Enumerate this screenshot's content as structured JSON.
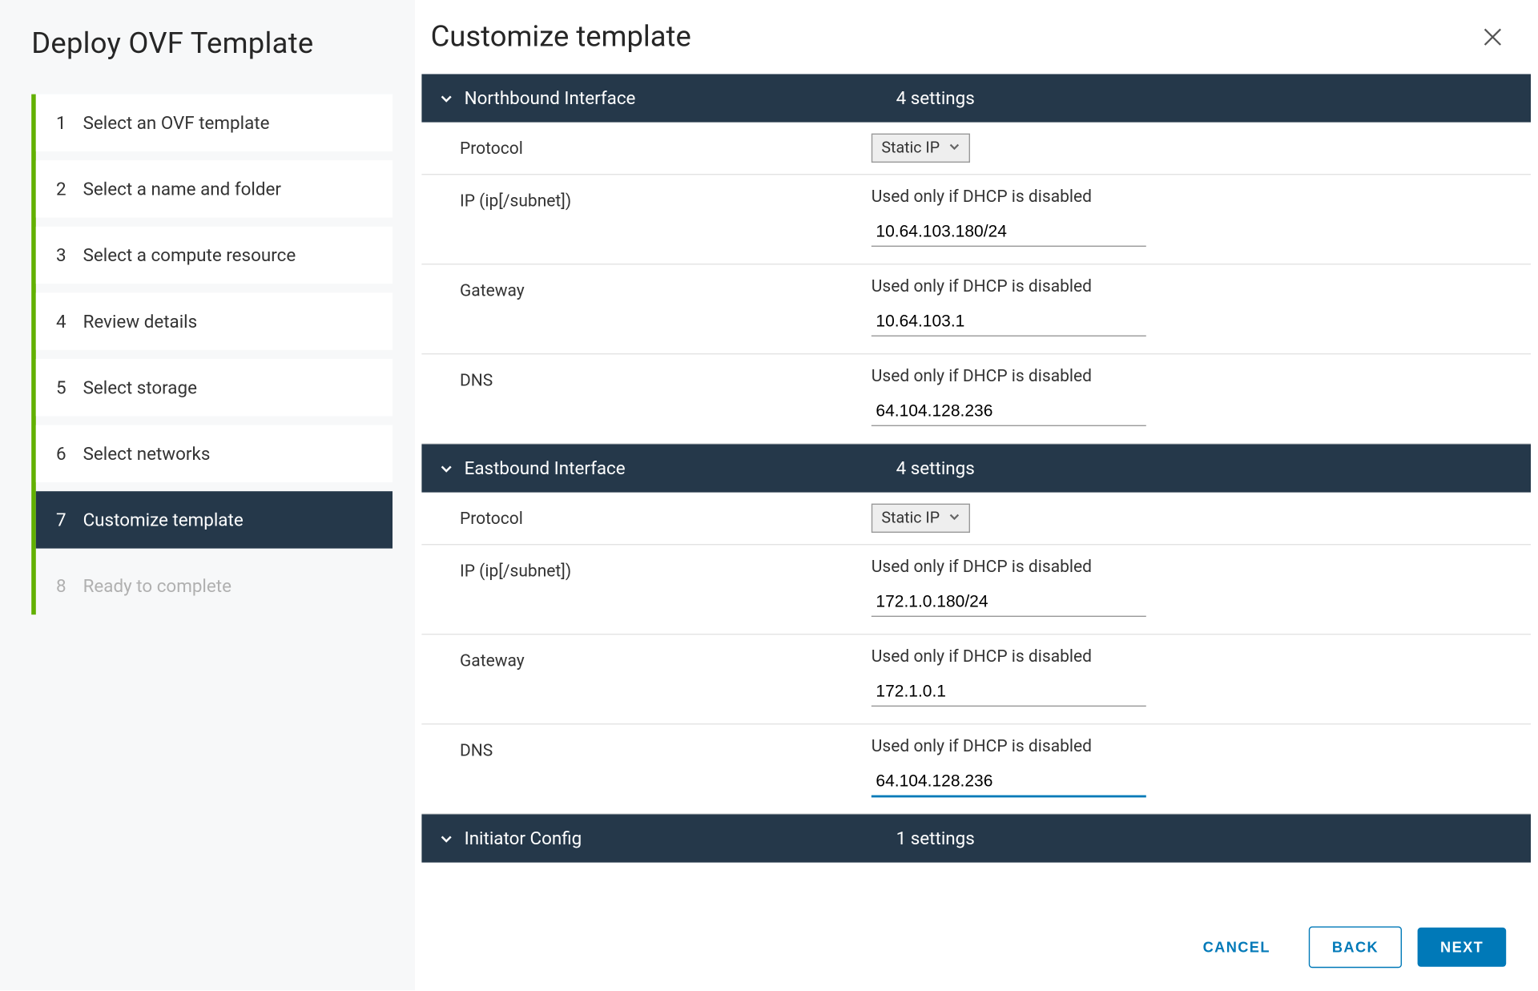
{
  "wizard": {
    "title": "Deploy OVF Template",
    "steps": [
      {
        "num": "1",
        "label": "Select an OVF template"
      },
      {
        "num": "2",
        "label": "Select a name and folder"
      },
      {
        "num": "3",
        "label": "Select a compute resource"
      },
      {
        "num": "4",
        "label": "Review details"
      },
      {
        "num": "5",
        "label": "Select storage"
      },
      {
        "num": "6",
        "label": "Select networks"
      },
      {
        "num": "7",
        "label": "Customize template"
      },
      {
        "num": "8",
        "label": "Ready to complete"
      }
    ],
    "active_index": 6
  },
  "main": {
    "title": "Customize template"
  },
  "sections": [
    {
      "title": "Northbound Interface",
      "count_label": "4 settings",
      "fields": [
        {
          "label": "Protocol",
          "type": "select",
          "value": "Static IP"
        },
        {
          "label": "IP (ip[/subnet])",
          "type": "text",
          "hint": "Used only if DHCP is disabled",
          "value": "10.64.103.180/24"
        },
        {
          "label": "Gateway",
          "type": "text",
          "hint": "Used only if DHCP is disabled",
          "value": "10.64.103.1"
        },
        {
          "label": "DNS",
          "type": "text",
          "hint": "Used only if DHCP is disabled",
          "value": "64.104.128.236"
        }
      ]
    },
    {
      "title": "Eastbound Interface",
      "count_label": "4 settings",
      "fields": [
        {
          "label": "Protocol",
          "type": "select",
          "value": "Static IP"
        },
        {
          "label": "IP (ip[/subnet])",
          "type": "text",
          "hint": "Used only if DHCP is disabled",
          "value": "172.1.0.180/24"
        },
        {
          "label": "Gateway",
          "type": "text",
          "hint": "Used only if DHCP is disabled",
          "value": "172.1.0.1"
        },
        {
          "label": "DNS",
          "type": "text",
          "hint": "Used only if DHCP is disabled",
          "value": "64.104.128.236",
          "focused": true
        }
      ]
    },
    {
      "title": "Initiator Config",
      "count_label": "1 settings",
      "fields": []
    }
  ],
  "footer": {
    "cancel": "CANCEL",
    "back": "BACK",
    "next": "NEXT"
  }
}
